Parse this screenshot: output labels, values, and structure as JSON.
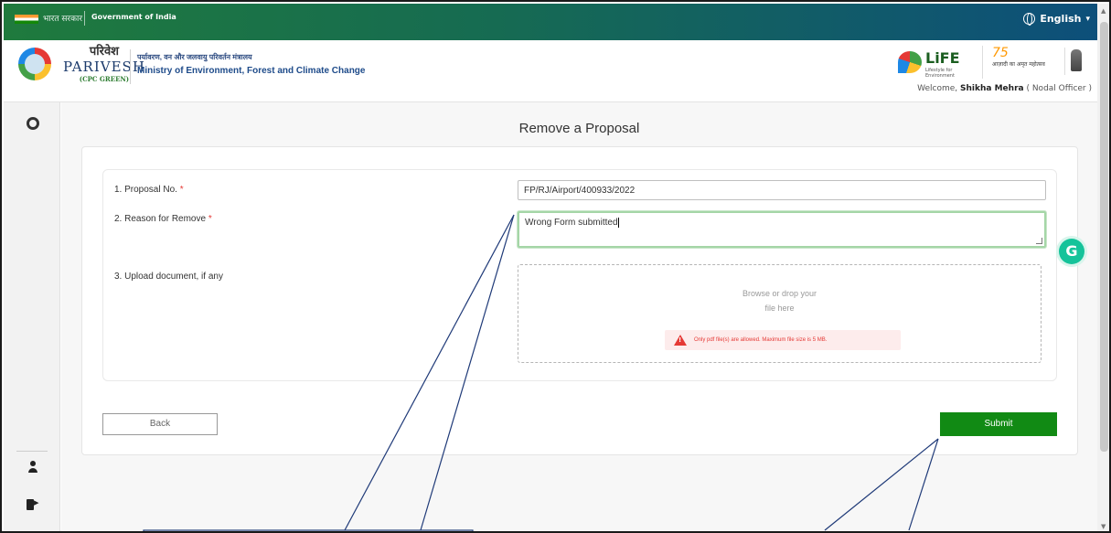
{
  "gov_bar": {
    "hindi": "भारत सरकार",
    "english": "Government of India",
    "language": "English"
  },
  "brand": {
    "hindi": "परिवेश",
    "english": "PARIVESH",
    "sub": "(CPC GREEN)"
  },
  "ministry": {
    "hindi": "पर्यावरण, वन और जलवायु परिवर्तन मंत्रालय",
    "english": "Ministry of Environment, Forest and Climate Change"
  },
  "life_logo": {
    "text": "LiFE",
    "sub": "Lifestyle for Environment"
  },
  "azadi_logo": {
    "number": "75",
    "text": "आज़ादी का अमृत महोत्सव"
  },
  "welcome": {
    "prefix": "Welcome, ",
    "name": "Shikha Mehra",
    "role": " ( Nodal Officer )"
  },
  "page": {
    "title": "Remove a Proposal"
  },
  "form": {
    "proposal_no_label": "1. Proposal No.",
    "proposal_no_value": "FP/RJ/Airport/400933/2022",
    "reason_label": "2. Reason for Remove",
    "reason_value": "Wrong Form submitted",
    "upload_label": "3. Upload document, if any",
    "required_mark": "*",
    "drop_line1": "Browse or drop your",
    "drop_line2": "file here",
    "warning": "Only pdf file(s) are allowed. Maximum file size is 5 MB.",
    "back_label": "Back",
    "submit_label": "Submit"
  },
  "grammarly": {
    "letter": "G"
  },
  "colors": {
    "accent_green": "#118a14",
    "header_gradient_start": "#1f7a3d",
    "header_gradient_end": "#0d4f7a",
    "warning_red": "#e53935",
    "callout_line": "#1f3a78"
  }
}
